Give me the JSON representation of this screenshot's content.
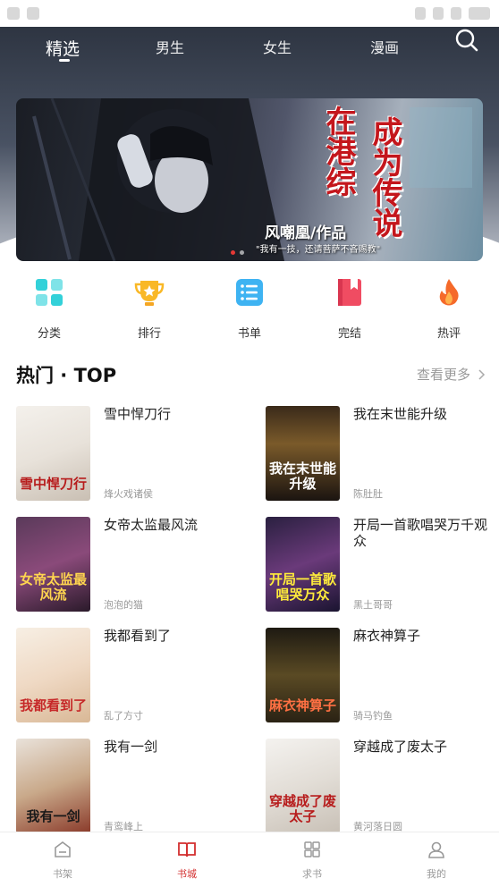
{
  "nav": {
    "tabs": [
      {
        "label": "精选",
        "active": true
      },
      {
        "label": "男生"
      },
      {
        "label": "女生"
      },
      {
        "label": "漫画"
      }
    ],
    "search_icon": "search-icon"
  },
  "banner": {
    "title_a": "在港综",
    "title_b": "成为传说",
    "author": "风嘲凰/作品",
    "quote": "\"我有一技，还请菩萨不吝赐教\"",
    "accent": "#c4161c"
  },
  "categories": [
    {
      "label": "分类",
      "icon": "grid-icon",
      "color": "#33d1d9"
    },
    {
      "label": "排行",
      "icon": "trophy-icon",
      "color": "#f9b826"
    },
    {
      "label": "书单",
      "icon": "list-icon",
      "color": "#3eb3f2"
    },
    {
      "label": "完结",
      "icon": "bookmark-book-icon",
      "color": "#f04c62"
    },
    {
      "label": "热评",
      "icon": "flame-icon",
      "color": "#f56a2a"
    }
  ],
  "section": {
    "title": "热门 · TOP",
    "more": "查看更多"
  },
  "books": [
    {
      "title": "雪中悍刀行",
      "author": "烽火戏诸侯",
      "cover_text": "雪中悍刀行"
    },
    {
      "title": "我在末世能升级",
      "author": "陈肚肚",
      "cover_text": "我在末世能升级"
    },
    {
      "title": "女帝太监最风流",
      "author": "泡泡的猫",
      "cover_text": "女帝太监最风流"
    },
    {
      "title": "开局一首歌唱哭万千观众",
      "author": "黑土哥哥",
      "cover_text": "开局一首歌唱哭万众"
    },
    {
      "title": "我都看到了",
      "author": "乱了方寸",
      "cover_text": "我都看到了"
    },
    {
      "title": "麻衣神算子",
      "author": "骑马钓鱼",
      "cover_text": "麻衣神算子"
    },
    {
      "title": "我有一剑",
      "author": "青鸾峰上",
      "cover_text": "我有一剑"
    },
    {
      "title": "穿越成了废太子",
      "author": "黄河落日圆",
      "cover_text": "穿越成了废太子"
    }
  ],
  "tabbar": [
    {
      "label": "书架",
      "icon": "bookshelf-icon"
    },
    {
      "label": "书城",
      "icon": "open-book-icon",
      "active": true
    },
    {
      "label": "求书",
      "icon": "apps-grid-icon"
    },
    {
      "label": "我的",
      "icon": "user-icon"
    }
  ],
  "colors": {
    "accent": "#d32f2f",
    "muted_text": "#999999"
  }
}
